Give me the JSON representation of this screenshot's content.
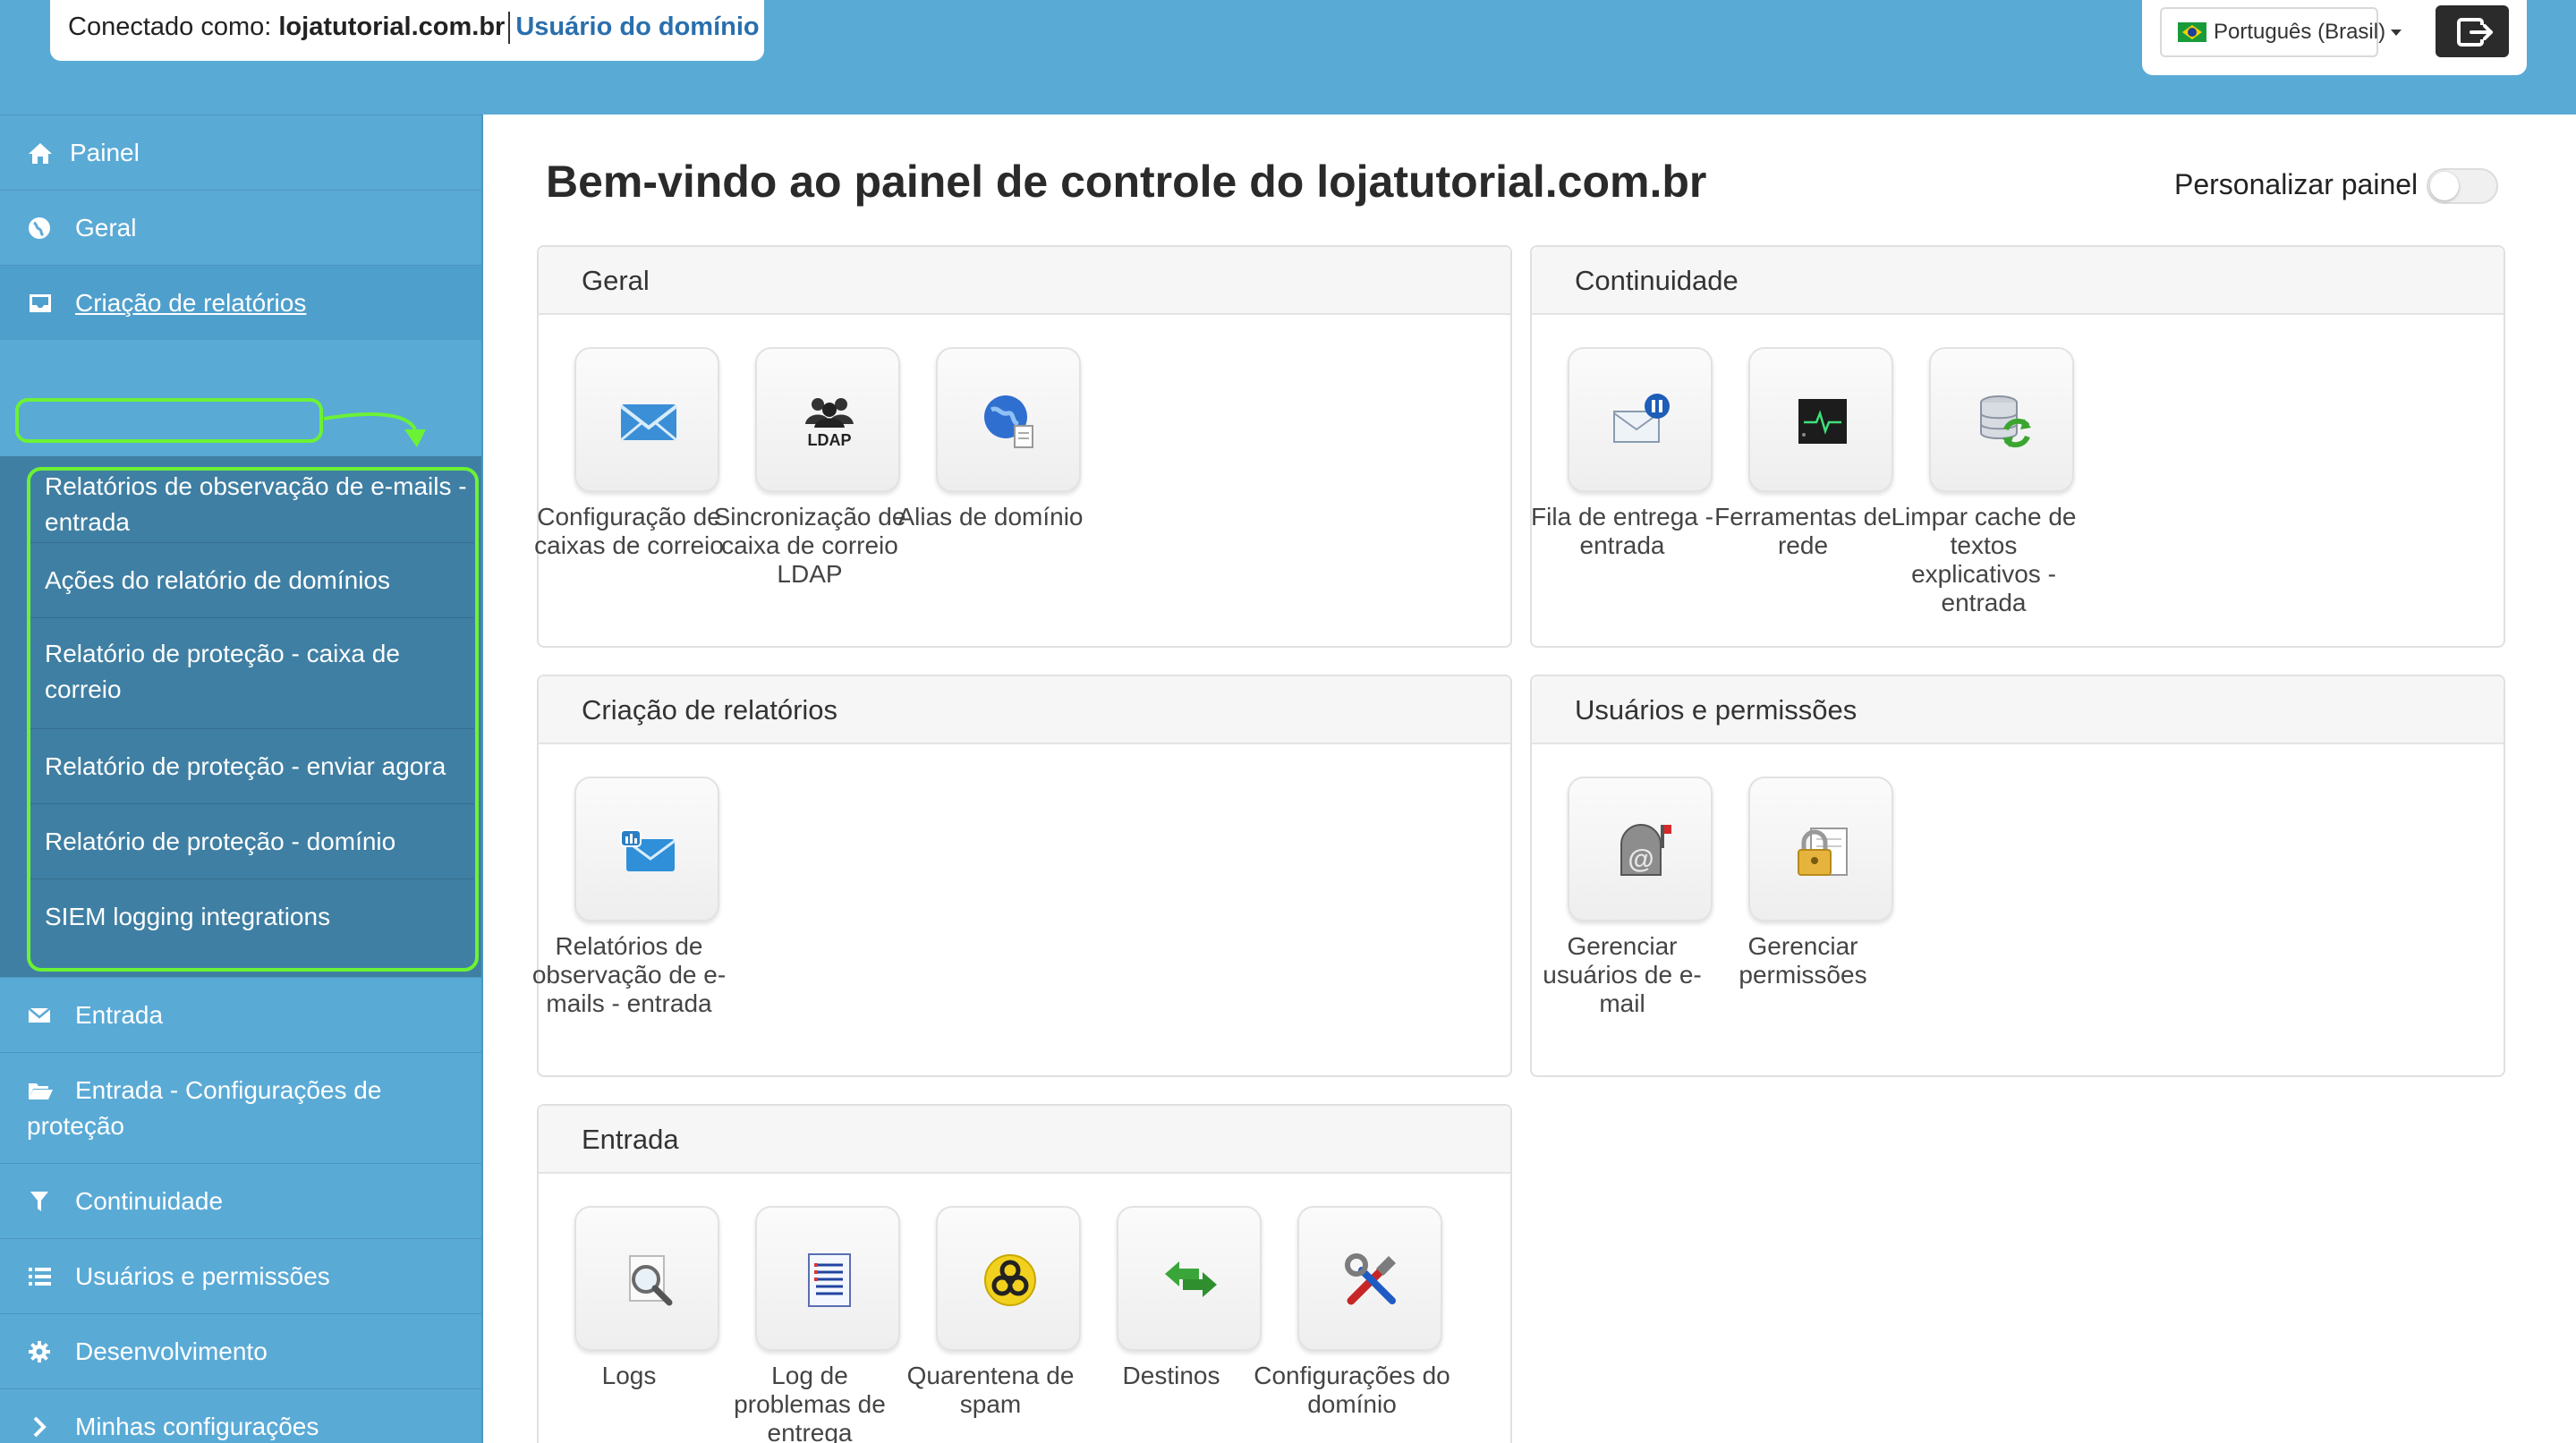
{
  "header": {
    "connected_label": "Conectado como:",
    "domain": "lojatutorial.com.br",
    "role": "Usuário do domínio",
    "language": "Português (Brasil)"
  },
  "sidebar": {
    "items": [
      {
        "label": "Painel",
        "icon": "home-icon"
      },
      {
        "label": "Geral",
        "icon": "globe-icon"
      },
      {
        "label": "Criação de relatórios",
        "icon": "inbox-icon"
      },
      {
        "label": "Entrada",
        "icon": "envelope-icon"
      },
      {
        "label": "Entrada - Configurações de proteção",
        "icon": "folder-open-icon"
      },
      {
        "label": "Continuidade",
        "icon": "filter-icon"
      },
      {
        "label": "Usuários e permissões",
        "icon": "list-icon"
      },
      {
        "label": "Desenvolvimento",
        "icon": "gear-icon"
      },
      {
        "label": "Minhas configurações",
        "icon": "chevron-right-icon"
      }
    ],
    "submenu": [
      "Relatórios de observação de e-mails - entrada",
      "Ações do relatório de domínios",
      "Relatório de proteção - caixa de correio",
      "Relatório de proteção - enviar agora",
      "Relatório de proteção - domínio",
      "SIEM logging integrations"
    ]
  },
  "main": {
    "title": "Bem-vindo ao painel de controle do lojatutorial.com.br",
    "customize_label": "Personalizar painel",
    "panels": {
      "geral": {
        "title": "Geral",
        "tiles": [
          "Configuração de caixas de correio",
          "Sincronização de caixa de correio LDAP",
          "Alias de domínio"
        ]
      },
      "continuidade": {
        "title": "Continuidade",
        "tiles": [
          "Fila de entrega - entrada",
          "Ferramentas de rede",
          "Limpar cache de textos explicativos - entrada"
        ]
      },
      "relatorios": {
        "title": "Criação de relatórios",
        "tiles": [
          "Relatórios de observação de e-mails - entrada"
        ]
      },
      "usuarios": {
        "title": "Usuários e permissões",
        "tiles": [
          "Gerenciar usuários de e-mail",
          "Gerenciar permissões"
        ]
      },
      "entrada": {
        "title": "Entrada",
        "tiles": [
          "Logs",
          "Log de problemas de entrega",
          "Quarentena de spam",
          "Destinos",
          "Configurações do domínio"
        ]
      }
    }
  },
  "colors": {
    "header_blue": "#5aaad6",
    "submenu_blue": "#3f7fa3",
    "highlight_green": "#6cf235",
    "link_blue": "#2a6fad"
  }
}
